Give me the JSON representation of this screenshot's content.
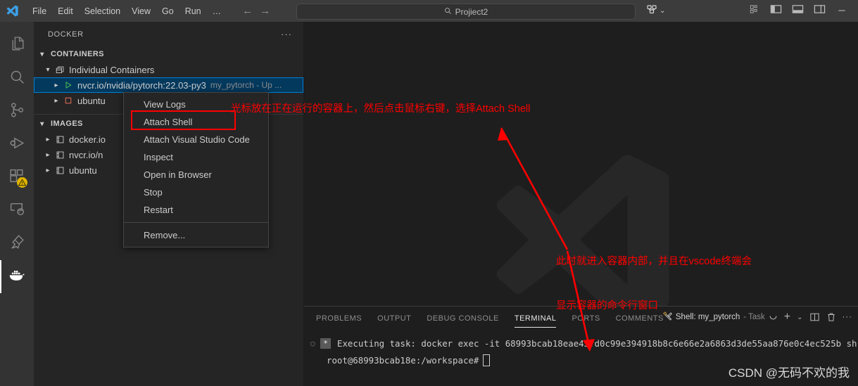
{
  "titlebar": {
    "logo_icon": "vscode-logo-icon",
    "menus": [
      {
        "label": "File"
      },
      {
        "label": "Edit"
      },
      {
        "label": "Selection"
      },
      {
        "label": "View"
      },
      {
        "label": "Go"
      },
      {
        "label": "Run"
      },
      {
        "label": "…"
      }
    ],
    "nav_back": "←",
    "nav_forward": "→",
    "quickinput": {
      "icon": "search-icon",
      "value": "Projiect2"
    },
    "accounts": {
      "icon": "remote-accounts-icon",
      "chevron": "⌄"
    },
    "layout_controls": [
      {
        "name": "customize-layout-icon"
      },
      {
        "name": "toggle-primary-sidebar-icon"
      },
      {
        "name": "toggle-panel-icon"
      },
      {
        "name": "toggle-secondary-sidebar-icon"
      }
    ],
    "window_minimize": "─"
  },
  "activitybar": {
    "items": [
      {
        "name": "explorer",
        "icon": "files-icon",
        "active": false
      },
      {
        "name": "search",
        "icon": "search-icon",
        "active": false
      },
      {
        "name": "source-control",
        "icon": "source-control-icon",
        "active": false
      },
      {
        "name": "run-and-debug",
        "icon": "run-debug-icon",
        "active": false
      },
      {
        "name": "extensions",
        "icon": "extensions-icon",
        "active": false,
        "badge": "warning"
      },
      {
        "name": "remote-explorer",
        "icon": "remote-explorer-icon",
        "active": false
      },
      {
        "name": "testing",
        "icon": "testing-beaker-icon",
        "active": false
      },
      {
        "name": "docker",
        "icon": "docker-whale-icon",
        "active": true
      }
    ]
  },
  "sidebar": {
    "title": "DOCKER",
    "more_actions": "···",
    "containers": {
      "header": "CONTAINERS",
      "group_label": "Individual Containers",
      "group_icon": "containers-group-icon",
      "rows": [
        {
          "label": "nvcr.io/nvidia/pytorch:22.03-py3",
          "description": "my_pytorch - Up ...",
          "status_icon": "running-play-icon",
          "selected": true
        },
        {
          "label": "ubuntu",
          "description": "",
          "status_icon": "stopped-square-icon",
          "selected": false
        }
      ]
    },
    "images": {
      "header": "IMAGES",
      "rows": [
        {
          "label": "docker.io",
          "icon": "image-icon"
        },
        {
          "label": "nvcr.io/n",
          "icon": "image-icon"
        },
        {
          "label": "ubuntu",
          "icon": "image-icon"
        }
      ]
    }
  },
  "context_menu": {
    "items": [
      {
        "label": "View Logs",
        "highlighted": false
      },
      {
        "label": "Attach Shell",
        "highlighted": true
      },
      {
        "label": "Attach Visual Studio Code",
        "highlighted": false
      },
      {
        "label": "Inspect",
        "highlighted": false
      },
      {
        "label": "Open in Browser",
        "highlighted": false
      },
      {
        "label": "Stop",
        "highlighted": false
      },
      {
        "label": "Restart",
        "highlighted": false
      },
      {
        "separator": true
      },
      {
        "label": "Remove...",
        "highlighted": false
      }
    ]
  },
  "panel": {
    "tabs": [
      {
        "label": "PROBLEMS",
        "active": false
      },
      {
        "label": "OUTPUT",
        "active": false
      },
      {
        "label": "DEBUG CONSOLE",
        "active": false
      },
      {
        "label": "TERMINAL",
        "active": true
      },
      {
        "label": "PORTS",
        "active": false
      },
      {
        "label": "COMMENTS",
        "active": false
      }
    ],
    "terminal_selector": {
      "icon": "tools-task-icon",
      "name": "Shell: my_pytorch",
      "sub": "- Task",
      "spinner": "loading-spinner-icon"
    },
    "actions": [
      {
        "name": "new-terminal-icon",
        "label": "+"
      },
      {
        "name": "terminal-profile-chevron-icon",
        "label": "⌄"
      },
      {
        "name": "split-terminal-icon"
      },
      {
        "name": "kill-terminal-icon"
      },
      {
        "name": "panel-more-actions-icon",
        "label": "···"
      }
    ],
    "terminal_lines": [
      {
        "type": "task",
        "bullet": "○",
        "chip": "*",
        "text": "Executing task: docker exec -it 68993bcab18eae45fd0c99e394918b8c6e66e2a6863d3de55aa876e0c4ec525b sh"
      },
      {
        "type": "prompt",
        "text": "root@68993bcab18e:/workspace#"
      }
    ]
  },
  "annotations": {
    "note_1": "光标放在正在运行的容器上，然后点击鼠标右键，选择Attach Shell",
    "note_2_line1": "此时就进入容器内部，并且在vscode终端会",
    "note_2_line2": "显示容器的命令行窗口",
    "color": "#ff0000"
  },
  "watermark": {
    "text": "CSDN @无码不欢的我"
  }
}
